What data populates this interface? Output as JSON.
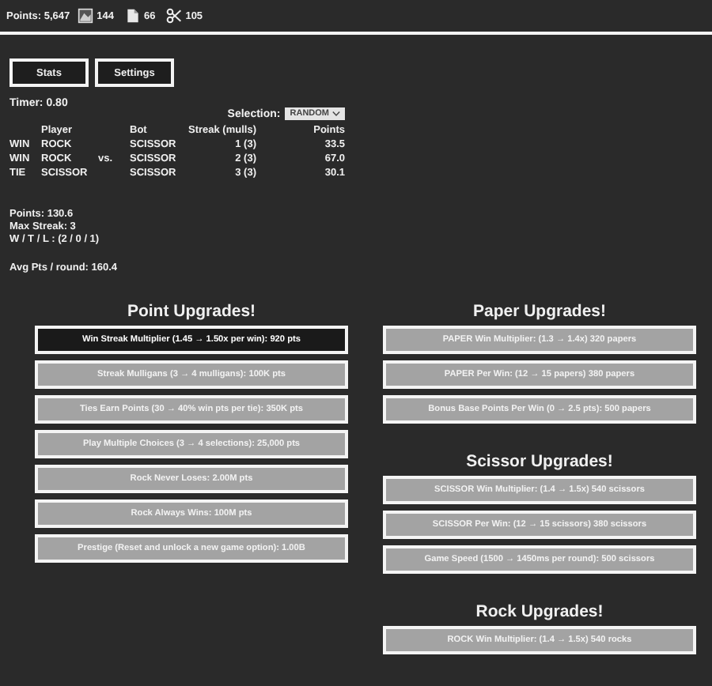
{
  "resources": {
    "points": "Points: 5,647",
    "items": [
      {
        "kind": "rock",
        "count": "144"
      },
      {
        "kind": "paper",
        "count": "66"
      },
      {
        "kind": "scissors",
        "count": "105"
      }
    ]
  },
  "buttons": [
    {
      "label": "Stats"
    },
    {
      "label": "Settings"
    }
  ],
  "timer": "Timer: 0.80",
  "selection": {
    "label": "Selection:",
    "value": "RANDOM"
  },
  "rounds": {
    "columns": [
      "Player",
      "Bot",
      "Streak (mulls)",
      "Points"
    ],
    "rows": [
      {
        "result": "WIN",
        "player": "ROCK",
        "bot": "SCISSOR",
        "streak": "1 (3)",
        "points": "33.5"
      },
      {
        "result": "WIN",
        "player": "ROCK",
        "vs": "vs.",
        "bot": "SCISSOR",
        "streak": "2 (3)",
        "points": "67.0"
      },
      {
        "result": "TIE",
        "player": "SCISSOR",
        "bot": "SCISSOR",
        "streak": "3 (3)",
        "points": "30.1"
      }
    ]
  },
  "summary": [
    "Points: 130.6",
    "Max Streak: 3",
    "W / T / L : (2 / 0 / 1)"
  ],
  "average": "Avg Pts / round: 160.4",
  "upgrade_columns": [
    [
      {
        "title": "Point Upgrades!",
        "upgrades": [
          {
            "label": "Win Streak Multiplier (1.45 → 1.50x per win): 920 pts",
            "disabled": false
          },
          {
            "label": "Streak Mulligans (3 → 4 mulligans): 100K pts",
            "disabled": true
          },
          {
            "label": "Ties Earn Points (30 → 40% win pts per tie): 350K pts",
            "disabled": true
          },
          {
            "label": "Play Multiple Choices (3 → 4 selections): 25,000 pts",
            "disabled": true
          },
          {
            "label": "Rock Never Loses: 2.00M pts",
            "disabled": true
          },
          {
            "label": "Rock Always Wins: 100M pts",
            "disabled": true
          },
          {
            "label": "Prestige (Reset and unlock a new game option): 1.00B",
            "disabled": true
          }
        ]
      }
    ],
    [
      {
        "title": "Paper Upgrades!",
        "upgrades": [
          {
            "label": "PAPER Win Multiplier: (1.3 → 1.4x) 320 papers",
            "disabled": true
          },
          {
            "label": "PAPER Per Win: (12 → 15 papers) 380 papers",
            "disabled": true
          },
          {
            "label": "Bonus Base Points Per Win (0 → 2.5 pts): 500 papers",
            "disabled": true
          }
        ]
      },
      {
        "title": "Scissor Upgrades!",
        "upgrades": [
          {
            "label": "SCISSOR Win Multiplier: (1.4 → 1.5x) 540 scissors",
            "disabled": true
          },
          {
            "label": "SCISSOR Per Win: (12 → 15 scissors) 380 scissors",
            "disabled": true
          },
          {
            "label": "Game Speed (1500 → 1450ms per round): 500 scissors",
            "disabled": true
          }
        ]
      },
      {
        "title": "Rock Upgrades!",
        "upgrades": [
          {
            "label": "ROCK Win Multiplier: (1.4 → 1.5x) 540 rocks",
            "disabled": true
          }
        ]
      }
    ]
  ]
}
